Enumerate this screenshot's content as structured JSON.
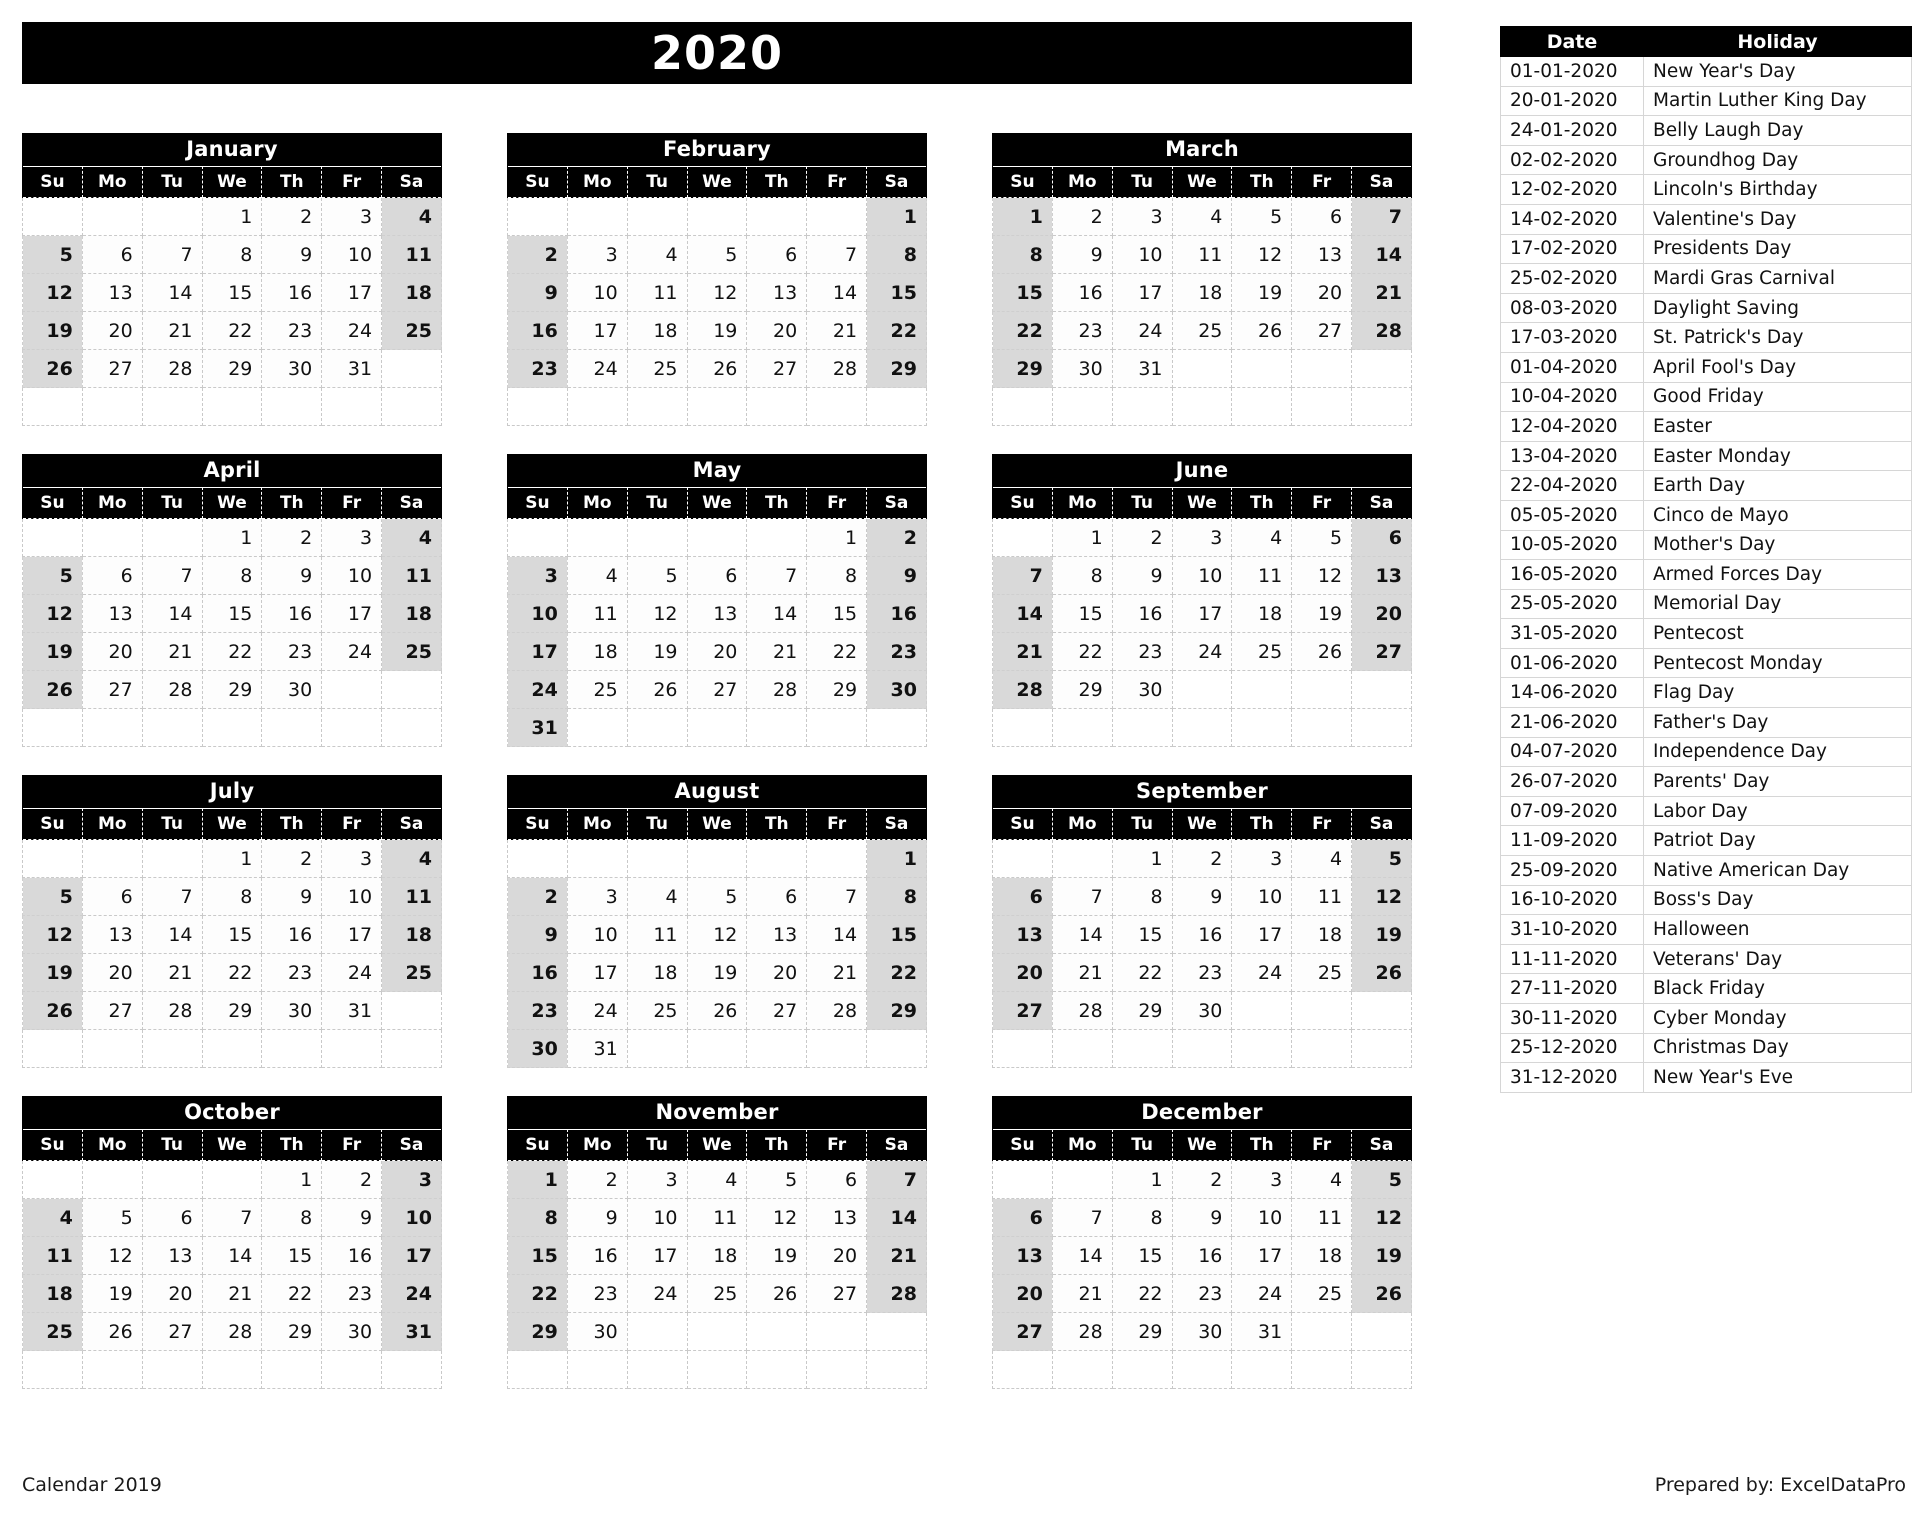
{
  "header": {
    "year_title": "2020"
  },
  "weekday_headers": [
    "Su",
    "Mo",
    "Tu",
    "We",
    "Th",
    "Fr",
    "Sa"
  ],
  "months": [
    {
      "name": "January",
      "weeks": [
        [
          "",
          "",
          "",
          "1",
          "2",
          "3",
          "4"
        ],
        [
          "5",
          "6",
          "7",
          "8",
          "9",
          "10",
          "11"
        ],
        [
          "12",
          "13",
          "14",
          "15",
          "16",
          "17",
          "18"
        ],
        [
          "19",
          "20",
          "21",
          "22",
          "23",
          "24",
          "25"
        ],
        [
          "26",
          "27",
          "28",
          "29",
          "30",
          "31",
          ""
        ],
        [
          "",
          "",
          "",
          "",
          "",
          "",
          ""
        ]
      ]
    },
    {
      "name": "February",
      "weeks": [
        [
          "",
          "",
          "",
          "",
          "",
          "",
          "1"
        ],
        [
          "2",
          "3",
          "4",
          "5",
          "6",
          "7",
          "8"
        ],
        [
          "9",
          "10",
          "11",
          "12",
          "13",
          "14",
          "15"
        ],
        [
          "16",
          "17",
          "18",
          "19",
          "20",
          "21",
          "22"
        ],
        [
          "23",
          "24",
          "25",
          "26",
          "27",
          "28",
          "29"
        ],
        [
          "",
          "",
          "",
          "",
          "",
          "",
          ""
        ]
      ]
    },
    {
      "name": "March",
      "weeks": [
        [
          "1",
          "2",
          "3",
          "4",
          "5",
          "6",
          "7"
        ],
        [
          "8",
          "9",
          "10",
          "11",
          "12",
          "13",
          "14"
        ],
        [
          "15",
          "16",
          "17",
          "18",
          "19",
          "20",
          "21"
        ],
        [
          "22",
          "23",
          "24",
          "25",
          "26",
          "27",
          "28"
        ],
        [
          "29",
          "30",
          "31",
          "",
          "",
          "",
          ""
        ],
        [
          "",
          "",
          "",
          "",
          "",
          "",
          ""
        ]
      ]
    },
    {
      "name": "April",
      "weeks": [
        [
          "",
          "",
          "",
          "1",
          "2",
          "3",
          "4"
        ],
        [
          "5",
          "6",
          "7",
          "8",
          "9",
          "10",
          "11"
        ],
        [
          "12",
          "13",
          "14",
          "15",
          "16",
          "17",
          "18"
        ],
        [
          "19",
          "20",
          "21",
          "22",
          "23",
          "24",
          "25"
        ],
        [
          "26",
          "27",
          "28",
          "29",
          "30",
          "",
          ""
        ],
        [
          "",
          "",
          "",
          "",
          "",
          "",
          ""
        ]
      ]
    },
    {
      "name": "May",
      "weeks": [
        [
          "",
          "",
          "",
          "",
          "",
          "1",
          "2"
        ],
        [
          "3",
          "4",
          "5",
          "6",
          "7",
          "8",
          "9"
        ],
        [
          "10",
          "11",
          "12",
          "13",
          "14",
          "15",
          "16"
        ],
        [
          "17",
          "18",
          "19",
          "20",
          "21",
          "22",
          "23"
        ],
        [
          "24",
          "25",
          "26",
          "27",
          "28",
          "29",
          "30"
        ],
        [
          "31",
          "",
          "",
          "",
          "",
          "",
          ""
        ]
      ]
    },
    {
      "name": "June",
      "weeks": [
        [
          "",
          "1",
          "2",
          "3",
          "4",
          "5",
          "6"
        ],
        [
          "7",
          "8",
          "9",
          "10",
          "11",
          "12",
          "13"
        ],
        [
          "14",
          "15",
          "16",
          "17",
          "18",
          "19",
          "20"
        ],
        [
          "21",
          "22",
          "23",
          "24",
          "25",
          "26",
          "27"
        ],
        [
          "28",
          "29",
          "30",
          "",
          "",
          "",
          ""
        ],
        [
          "",
          "",
          "",
          "",
          "",
          "",
          ""
        ]
      ]
    },
    {
      "name": "July",
      "weeks": [
        [
          "",
          "",
          "",
          "1",
          "2",
          "3",
          "4"
        ],
        [
          "5",
          "6",
          "7",
          "8",
          "9",
          "10",
          "11"
        ],
        [
          "12",
          "13",
          "14",
          "15",
          "16",
          "17",
          "18"
        ],
        [
          "19",
          "20",
          "21",
          "22",
          "23",
          "24",
          "25"
        ],
        [
          "26",
          "27",
          "28",
          "29",
          "30",
          "31",
          ""
        ],
        [
          "",
          "",
          "",
          "",
          "",
          "",
          ""
        ]
      ]
    },
    {
      "name": "August",
      "weeks": [
        [
          "",
          "",
          "",
          "",
          "",
          "",
          "1"
        ],
        [
          "2",
          "3",
          "4",
          "5",
          "6",
          "7",
          "8"
        ],
        [
          "9",
          "10",
          "11",
          "12",
          "13",
          "14",
          "15"
        ],
        [
          "16",
          "17",
          "18",
          "19",
          "20",
          "21",
          "22"
        ],
        [
          "23",
          "24",
          "25",
          "26",
          "27",
          "28",
          "29"
        ],
        [
          "30",
          "31",
          "",
          "",
          "",
          "",
          ""
        ]
      ]
    },
    {
      "name": "September",
      "weeks": [
        [
          "",
          "",
          "1",
          "2",
          "3",
          "4",
          "5"
        ],
        [
          "6",
          "7",
          "8",
          "9",
          "10",
          "11",
          "12"
        ],
        [
          "13",
          "14",
          "15",
          "16",
          "17",
          "18",
          "19"
        ],
        [
          "20",
          "21",
          "22",
          "23",
          "24",
          "25",
          "26"
        ],
        [
          "27",
          "28",
          "29",
          "30",
          "",
          "",
          ""
        ],
        [
          "",
          "",
          "",
          "",
          "",
          "",
          ""
        ]
      ]
    },
    {
      "name": "October",
      "weeks": [
        [
          "",
          "",
          "",
          "",
          "1",
          "2",
          "3"
        ],
        [
          "4",
          "5",
          "6",
          "7",
          "8",
          "9",
          "10"
        ],
        [
          "11",
          "12",
          "13",
          "14",
          "15",
          "16",
          "17"
        ],
        [
          "18",
          "19",
          "20",
          "21",
          "22",
          "23",
          "24"
        ],
        [
          "25",
          "26",
          "27",
          "28",
          "29",
          "30",
          "31"
        ],
        [
          "",
          "",
          "",
          "",
          "",
          "",
          ""
        ]
      ]
    },
    {
      "name": "November",
      "weeks": [
        [
          "1",
          "2",
          "3",
          "4",
          "5",
          "6",
          "7"
        ],
        [
          "8",
          "9",
          "10",
          "11",
          "12",
          "13",
          "14"
        ],
        [
          "15",
          "16",
          "17",
          "18",
          "19",
          "20",
          "21"
        ],
        [
          "22",
          "23",
          "24",
          "25",
          "26",
          "27",
          "28"
        ],
        [
          "29",
          "30",
          "",
          "",
          "",
          "",
          ""
        ],
        [
          "",
          "",
          "",
          "",
          "",
          "",
          ""
        ]
      ]
    },
    {
      "name": "December",
      "weeks": [
        [
          "",
          "",
          "1",
          "2",
          "3",
          "4",
          "5"
        ],
        [
          "6",
          "7",
          "8",
          "9",
          "10",
          "11",
          "12"
        ],
        [
          "13",
          "14",
          "15",
          "16",
          "17",
          "18",
          "19"
        ],
        [
          "20",
          "21",
          "22",
          "23",
          "24",
          "25",
          "26"
        ],
        [
          "27",
          "28",
          "29",
          "30",
          "31",
          "",
          ""
        ],
        [
          "",
          "",
          "",
          "",
          "",
          "",
          ""
        ]
      ]
    }
  ],
  "holiday_table": {
    "columns": [
      "Date",
      "Holiday"
    ],
    "rows": [
      [
        "01-01-2020",
        "New Year's Day"
      ],
      [
        "20-01-2020",
        "Martin Luther King Day"
      ],
      [
        "24-01-2020",
        "Belly Laugh Day"
      ],
      [
        "02-02-2020",
        "Groundhog Day"
      ],
      [
        "12-02-2020",
        "Lincoln's Birthday"
      ],
      [
        "14-02-2020",
        "Valentine's Day"
      ],
      [
        "17-02-2020",
        "Presidents Day"
      ],
      [
        "25-02-2020",
        "Mardi Gras Carnival"
      ],
      [
        "08-03-2020",
        "Daylight Saving"
      ],
      [
        "17-03-2020",
        "St. Patrick's Day"
      ],
      [
        "01-04-2020",
        "April Fool's Day"
      ],
      [
        "10-04-2020",
        "Good Friday"
      ],
      [
        "12-04-2020",
        "Easter"
      ],
      [
        "13-04-2020",
        "Easter Monday"
      ],
      [
        "22-04-2020",
        "Earth Day"
      ],
      [
        "05-05-2020",
        "Cinco de Mayo"
      ],
      [
        "10-05-2020",
        "Mother's Day"
      ],
      [
        "16-05-2020",
        "Armed Forces Day"
      ],
      [
        "25-05-2020",
        "Memorial Day"
      ],
      [
        "31-05-2020",
        "Pentecost"
      ],
      [
        "01-06-2020",
        "Pentecost Monday"
      ],
      [
        "14-06-2020",
        "Flag Day"
      ],
      [
        "21-06-2020",
        "Father's Day"
      ],
      [
        "04-07-2020",
        "Independence Day"
      ],
      [
        "26-07-2020",
        "Parents' Day"
      ],
      [
        "07-09-2020",
        "Labor Day"
      ],
      [
        "11-09-2020",
        "Patriot Day"
      ],
      [
        "25-09-2020",
        "Native American Day"
      ],
      [
        "16-10-2020",
        "Boss's Day"
      ],
      [
        "31-10-2020",
        "Halloween"
      ],
      [
        "11-11-2020",
        "Veterans' Day"
      ],
      [
        "27-11-2020",
        "Black Friday"
      ],
      [
        "30-11-2020",
        "Cyber Monday"
      ],
      [
        "25-12-2020",
        "Christmas Day"
      ],
      [
        "31-12-2020",
        "New Year's Eve"
      ]
    ]
  },
  "footer": {
    "left": "Calendar 2019",
    "right": "Prepared by: ExcelDataPro"
  },
  "colors": {
    "header_bg": "#000000",
    "header_text": "#ffffff",
    "weekend_bg": "#d9d9d9",
    "weekday_bg": "#fdfdfd",
    "grid_line": "#c9c9c9",
    "page_bg": "#ffffff"
  }
}
